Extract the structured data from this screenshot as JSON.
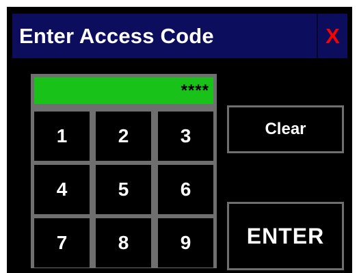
{
  "dialog": {
    "title": "Enter Access Code",
    "close_label": "X"
  },
  "keypad": {
    "display_value": "****",
    "keys": [
      "1",
      "2",
      "3",
      "4",
      "5",
      "6",
      "7",
      "8",
      "9"
    ]
  },
  "actions": {
    "clear_label": "Clear",
    "enter_label": "ENTER"
  },
  "colors": {
    "titlebar_bg": "#0d0d5e",
    "close_x": "#ff0000",
    "display_bg": "#18c218",
    "panel_bg": "#000000",
    "frame": "#6f6f6f"
  }
}
